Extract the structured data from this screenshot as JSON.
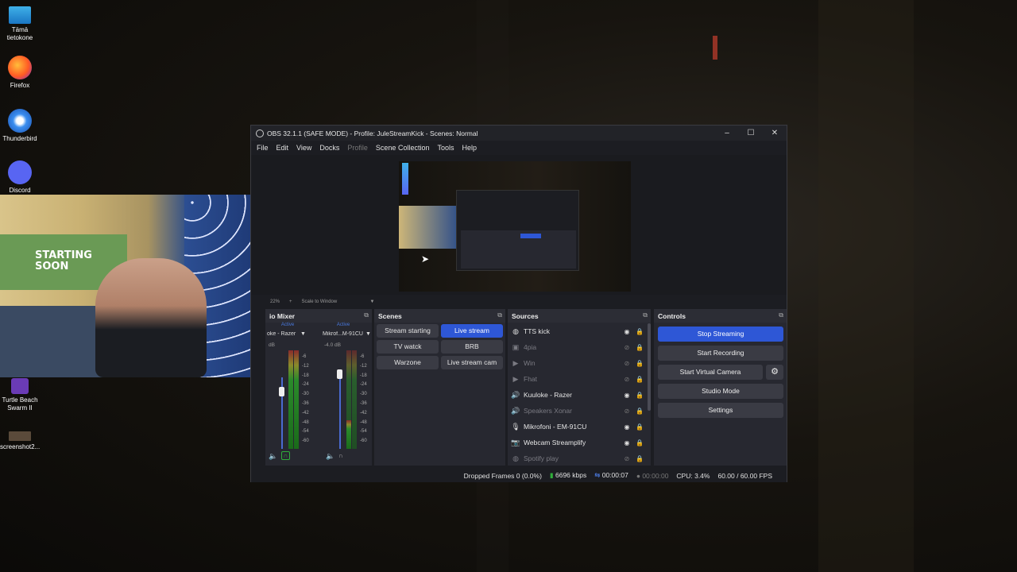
{
  "desktop": {
    "icons": [
      {
        "label": "Tämä tietokone",
        "name": "this-pc-icon"
      },
      {
        "label": "Firefox",
        "name": "firefox-icon"
      },
      {
        "label": "Thunderbird",
        "name": "thunderbird-icon"
      },
      {
        "label": "Discord",
        "name": "discord-icon"
      },
      {
        "label": "Turtle Beach Swarm II",
        "name": "turtle-beach-icon"
      },
      {
        "label": "screenshot2...",
        "name": "screenshot-file-icon"
      }
    ]
  },
  "webcam": {
    "poster_text": "STARTING SOON"
  },
  "window": {
    "title": "OBS 32.1.1 (SAFE MODE) - Profile: JuleStreamKick - Scenes: Normal",
    "controls": {
      "minimize": "–",
      "maximize": "☐",
      "close": "✕"
    }
  },
  "menu": [
    "File",
    "Edit",
    "View",
    "Docks",
    "Profile",
    "Scene Collection",
    "Tools",
    "Help"
  ],
  "preview": {
    "zoom": "22%",
    "plus": "+",
    "scale_mode": "Scale to Window"
  },
  "mixer": {
    "title": "io Mixer",
    "channels": [
      {
        "status": "Active",
        "name": "oke - Razer",
        "db": "dB"
      },
      {
        "status": "Active",
        "name": "Mikrof...M-91CU",
        "db": "-4.0 dB"
      }
    ],
    "ticks": [
      "-6",
      "-12",
      "-18",
      "-24",
      "-30",
      "-36",
      "-42",
      "-48",
      "-54",
      "-60"
    ]
  },
  "scenes": {
    "title": "Scenes",
    "items": [
      {
        "label": "Stream starting",
        "active": false
      },
      {
        "label": "Live stream",
        "active": true
      },
      {
        "label": "TV watck",
        "active": false
      },
      {
        "label": "BRB",
        "active": false
      },
      {
        "label": "Warzone",
        "active": false
      },
      {
        "label": "Live stream cam",
        "active": false
      }
    ]
  },
  "sources": {
    "title": "Sources",
    "items": [
      {
        "label": "TTS kick",
        "icon": "globe-icon",
        "glyph": "◍",
        "visible": true
      },
      {
        "label": "4pia",
        "icon": "image-icon",
        "glyph": "▣",
        "visible": false
      },
      {
        "label": "Win",
        "icon": "media-icon",
        "glyph": "▶",
        "visible": false
      },
      {
        "label": "Fhat",
        "icon": "media-icon",
        "glyph": "▶",
        "visible": false
      },
      {
        "label": "Kuuloke - Razer",
        "icon": "speaker-icon",
        "glyph": "🔊",
        "visible": true
      },
      {
        "label": "Speakers Xonar",
        "icon": "speaker-icon",
        "glyph": "🔊",
        "visible": false
      },
      {
        "label": "Mikrofoni - EM-91CU",
        "icon": "microphone-icon",
        "glyph": "🎙",
        "visible": true
      },
      {
        "label": "Webcam Streamplify",
        "icon": "camera-icon",
        "glyph": "📷",
        "visible": true
      },
      {
        "label": "Spotify play",
        "icon": "globe-icon",
        "glyph": "◍",
        "visible": false
      }
    ]
  },
  "controls": {
    "title": "Controls",
    "stop_streaming": "Stop Streaming",
    "start_recording": "Start Recording",
    "start_virtual_camera": "Start Virtual Camera",
    "studio_mode": "Studio Mode",
    "settings": "Settings"
  },
  "status": {
    "dropped_frames": "Dropped Frames 0 (0.0%)",
    "bitrate": "6696 kbps",
    "stream_time": "00:00:07",
    "record_time": "00:00:00",
    "cpu": "CPU: 3.4%",
    "fps": "60.00 / 60.00 FPS"
  },
  "colors": {
    "accent": "#2e57d6",
    "panel": "#272830",
    "window": "#1c1d22"
  }
}
